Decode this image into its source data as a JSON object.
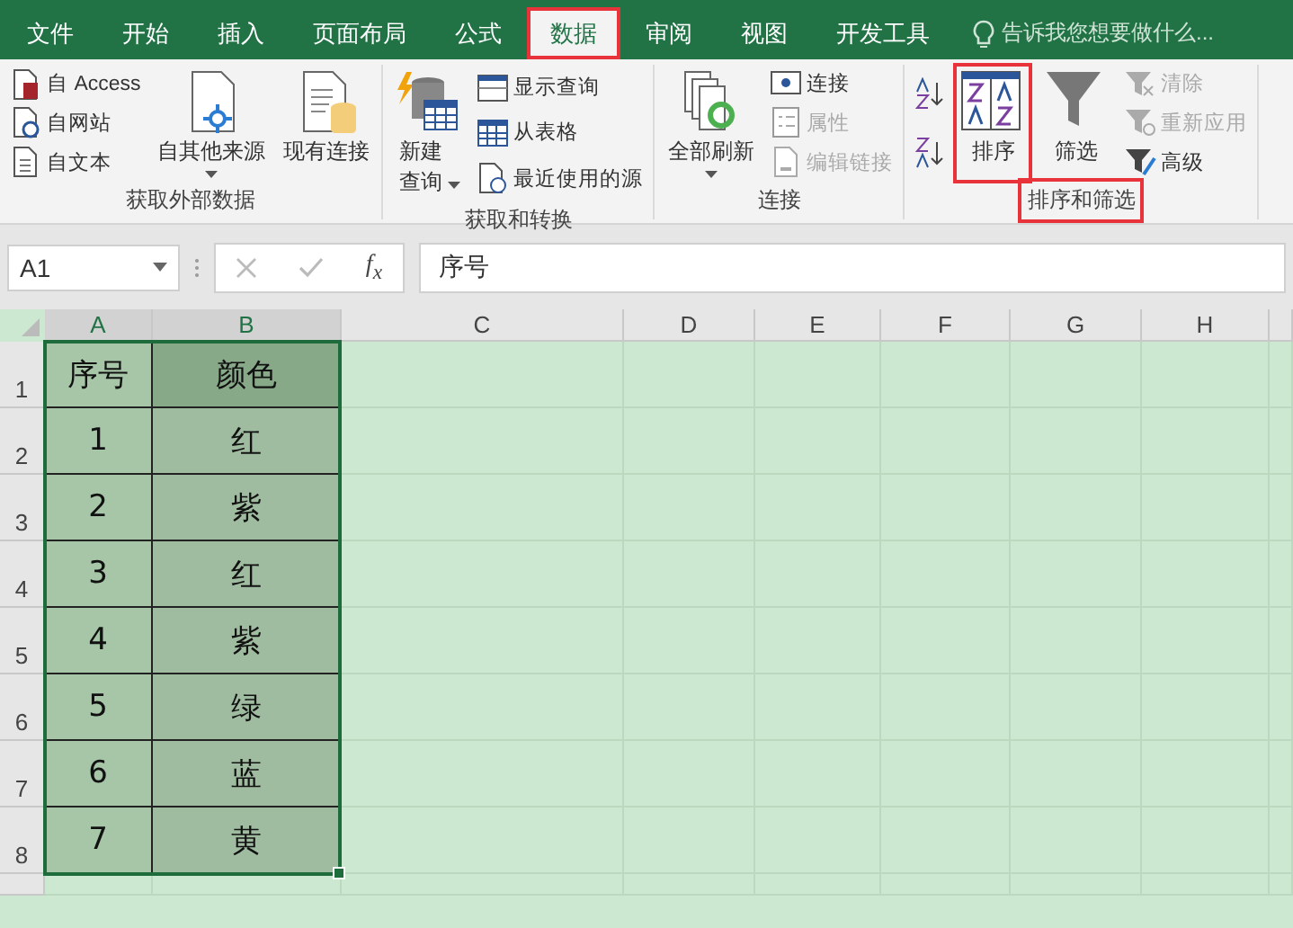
{
  "menu_tabs": [
    {
      "label": "文件",
      "selected": false,
      "highlighted": false
    },
    {
      "label": "开始",
      "selected": false,
      "highlighted": false
    },
    {
      "label": "插入",
      "selected": false,
      "highlighted": false
    },
    {
      "label": "页面布局",
      "selected": false,
      "highlighted": false
    },
    {
      "label": "公式",
      "selected": false,
      "highlighted": false
    },
    {
      "label": "数据",
      "selected": true,
      "highlighted": true
    },
    {
      "label": "审阅",
      "selected": false,
      "highlighted": false
    },
    {
      "label": "视图",
      "selected": false,
      "highlighted": false
    },
    {
      "label": "开发工具",
      "selected": false,
      "highlighted": false
    }
  ],
  "tell_me": {
    "placeholder": "告诉我您想要做什么..."
  },
  "ribbon_groups": [
    {
      "label": "获取外部数据",
      "highlighted": false,
      "blocks": [
        {
          "kind": "stack",
          "items": [
            {
              "label": "自 Access",
              "disabled": false
            },
            {
              "label": "自网站",
              "disabled": false
            },
            {
              "label": "自文本",
              "disabled": false
            }
          ]
        },
        {
          "kind": "large",
          "label": "自其他来源",
          "dropdown": true,
          "highlighted": false
        },
        {
          "kind": "large",
          "label": "现有连接",
          "dropdown": false,
          "highlighted": false
        }
      ]
    },
    {
      "label": "获取和转换",
      "highlighted": false,
      "blocks": [
        {
          "kind": "large",
          "label": "新建查询",
          "dropdown": true,
          "highlighted": false
        },
        {
          "kind": "stack",
          "items": [
            {
              "label": "显示查询",
              "disabled": false
            },
            {
              "label": "从表格",
              "disabled": false
            },
            {
              "label": "最近使用的源",
              "disabled": false
            }
          ]
        }
      ]
    },
    {
      "label": "连接",
      "highlighted": false,
      "blocks": [
        {
          "kind": "large",
          "label": "全部刷新",
          "dropdown": true,
          "highlighted": false
        },
        {
          "kind": "stack",
          "items": [
            {
              "label": "连接",
              "disabled": false
            },
            {
              "label": "属性",
              "disabled": true
            },
            {
              "label": "编辑链接",
              "disabled": true
            }
          ]
        }
      ]
    },
    {
      "label": "排序和筛选",
      "highlighted": true,
      "blocks": [
        {
          "kind": "sortpair"
        },
        {
          "kind": "large",
          "label": "排序",
          "dropdown": false,
          "highlighted": true
        },
        {
          "kind": "large",
          "label": "筛选",
          "dropdown": false,
          "highlighted": false
        },
        {
          "kind": "stack",
          "items": [
            {
              "label": "清除",
              "disabled": true
            },
            {
              "label": "重新应用",
              "disabled": true
            },
            {
              "label": "高级",
              "disabled": false
            }
          ]
        }
      ]
    }
  ],
  "formula_bar": {
    "name_box": "A1",
    "function_label": "f$_{x}$",
    "formula": "序号"
  },
  "sheet": {
    "columns": [
      {
        "label": "A",
        "selected": true
      },
      {
        "label": "B",
        "selected": true
      },
      {
        "label": "C",
        "selected": false
      },
      {
        "label": "D",
        "selected": false
      },
      {
        "label": "E",
        "selected": false
      },
      {
        "label": "F",
        "selected": false
      },
      {
        "label": "G",
        "selected": false
      },
      {
        "label": "H",
        "selected": false
      }
    ],
    "rows": [
      {
        "number": "1",
        "header": true,
        "cells": [
          "序号",
          "颜色"
        ]
      },
      {
        "number": "2",
        "header": false,
        "cells": [
          "1",
          "红"
        ]
      },
      {
        "number": "3",
        "header": false,
        "cells": [
          "2",
          "紫"
        ]
      },
      {
        "number": "4",
        "header": false,
        "cells": [
          "3",
          "红"
        ]
      },
      {
        "number": "5",
        "header": false,
        "cells": [
          "4",
          "紫"
        ]
      },
      {
        "number": "6",
        "header": false,
        "cells": [
          "5",
          "绿"
        ]
      },
      {
        "number": "7",
        "header": false,
        "cells": [
          "6",
          "蓝"
        ]
      },
      {
        "number": "8",
        "header": false,
        "cells": [
          "7",
          "黄"
        ]
      }
    ]
  }
}
